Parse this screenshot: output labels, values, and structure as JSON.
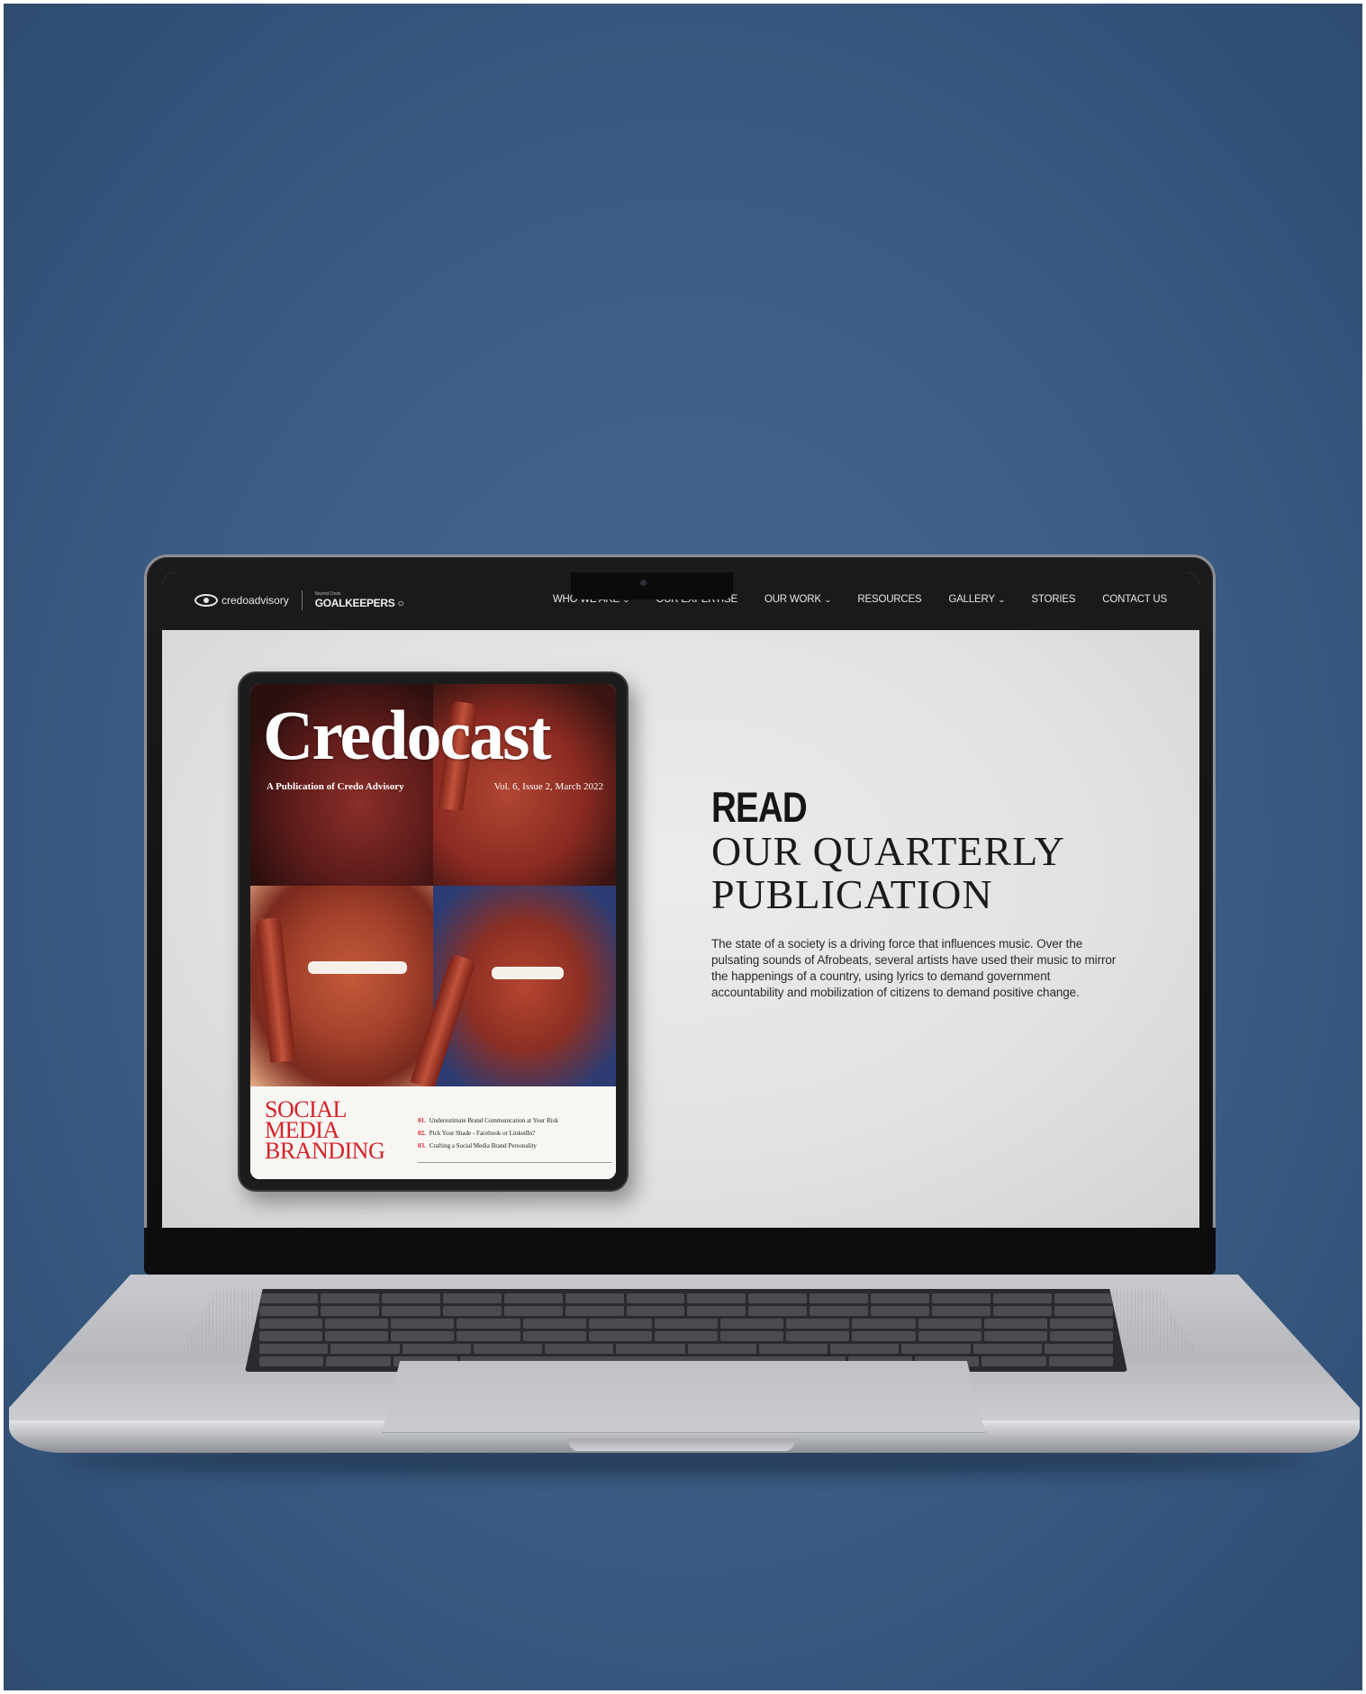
{
  "nav": {
    "logo_credo": "credoadvisory",
    "logo_gk_small": "Beyond Credo",
    "logo_gk": "GOALKEEPERS",
    "items": [
      {
        "label": "WHO WE ARE",
        "dropdown": true
      },
      {
        "label": "OUR EXPERTISE",
        "dropdown": false
      },
      {
        "label": "OUR WORK",
        "dropdown": true
      },
      {
        "label": "RESOURCES",
        "dropdown": false
      },
      {
        "label": "GALLERY",
        "dropdown": true
      },
      {
        "label": "STORIES",
        "dropdown": false
      },
      {
        "label": "CONTACT US",
        "dropdown": false
      }
    ]
  },
  "cover": {
    "title": "Credocast",
    "subtitle": "A Publication of Credo Advisory",
    "volume": "Vol. 6, Issue 2, March 2022",
    "feature_line1": "SOCIAL",
    "feature_line2": "MEDIA",
    "feature_line3": "BRANDING",
    "toc": [
      {
        "num": "01.",
        "text": "Underestimate Brand Communication at Your Risk"
      },
      {
        "num": "02.",
        "text": "Pick Your Shade - Facebook or LinkedIn?"
      },
      {
        "num": "03.",
        "text": "Crafting a Social Media Brand Personality"
      }
    ]
  },
  "hero": {
    "heading": "READ",
    "subheading_line1": "OUR QUARTERLY",
    "subheading_line2": "PUBLICATION",
    "body": "The state of a society is a driving force that influences music. Over the pulsating sounds of Afrobeats, several artists have used their music to mirror the happenings of a country, using lyrics to demand government accountability and mobilization of citizens to demand positive change."
  },
  "colors": {
    "background": "#3d5f86",
    "nav_bg": "#1a1a1a",
    "accent_red": "#d4232a"
  }
}
